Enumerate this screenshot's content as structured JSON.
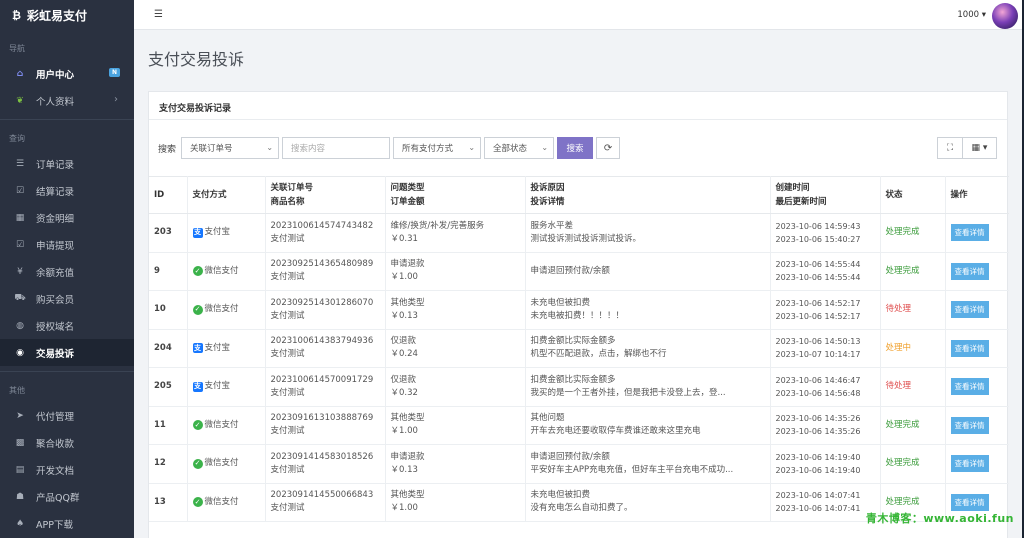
{
  "brand": {
    "logo": "₿",
    "name": "彩虹易支付"
  },
  "sidebar": {
    "section_nav": "导航",
    "section_query": "查询",
    "section_other": "其他",
    "nav_items": [
      {
        "label": "用户中心",
        "icon": "house-icon",
        "glyph": "⌂",
        "badge": "N"
      },
      {
        "label": "个人资料",
        "icon": "leaf-icon",
        "glyph": "❦",
        "arrow": "›"
      }
    ],
    "query_items": [
      {
        "label": "订单记录",
        "icon": "list-icon",
        "glyph": "☰"
      },
      {
        "label": "结算记录",
        "icon": "check-square-icon",
        "glyph": "☑"
      },
      {
        "label": "资金明细",
        "icon": "table-icon",
        "glyph": "▦"
      },
      {
        "label": "申请提现",
        "icon": "edit-icon",
        "glyph": "☑"
      },
      {
        "label": "余额充值",
        "icon": "yen-icon",
        "glyph": "¥"
      },
      {
        "label": "购买会员",
        "icon": "cart-icon",
        "glyph": "⛟"
      },
      {
        "label": "授权域名",
        "icon": "globe-icon",
        "glyph": "◍"
      },
      {
        "label": "交易投诉",
        "icon": "chat-icon",
        "glyph": "◉"
      }
    ],
    "other_items": [
      {
        "label": "代付管理",
        "icon": "send-icon",
        "glyph": "➤"
      },
      {
        "label": "聚合收款",
        "icon": "qrcode-icon",
        "glyph": "▩"
      },
      {
        "label": "开发文档",
        "icon": "book-icon",
        "glyph": "▤"
      },
      {
        "label": "产品QQ群",
        "icon": "qq-icon",
        "glyph": "☗"
      },
      {
        "label": "APP下载",
        "icon": "android-icon",
        "glyph": "♠"
      }
    ]
  },
  "topbar": {
    "account": "1000",
    "caret": "▾",
    "menu_glyph": "☰"
  },
  "page": {
    "title": "支付交易投诉"
  },
  "panel": {
    "title": "支付交易投诉记录"
  },
  "toolbar": {
    "search_label": "搜索",
    "field_select": "关联订单号",
    "search_placeholder": "搜索内容",
    "paytype_select": "所有支付方式",
    "status_select": "全部状态",
    "search_button": "搜索",
    "refresh_glyph": "⟳",
    "fullscreen_glyph": "⛶",
    "columns_glyph": "▦ ▾"
  },
  "table": {
    "headers": {
      "id": "ID",
      "pay": "支付方式",
      "order_1": "关联订单号",
      "order_2": "商品名称",
      "type_1": "问题类型",
      "type_2": "订单金额",
      "reason_1": "投诉原因",
      "reason_2": "投诉详情",
      "time_1": "创建时间",
      "time_2": "最后更新时间",
      "status": "状态",
      "op": "操作"
    },
    "rows": [
      {
        "id": "203",
        "pay": "支付宝",
        "pay_type": "alipay",
        "order": "2023100614574743482",
        "product": "支付测试",
        "type": "维修/换货/补发/完善服务",
        "amount": "￥0.31",
        "reason": "服务水平差",
        "detail": "测试投诉测试投诉测试投诉。",
        "created": "2023-10-06 14:59:43",
        "updated": "2023-10-06 15:40:27",
        "status": "处理完成",
        "status_kind": "done",
        "op": "查看详情"
      },
      {
        "id": "9",
        "pay": "微信支付",
        "pay_type": "wechat",
        "order": "2023092514365480989",
        "product": "支付测试",
        "type": "申请退款",
        "amount": "￥1.00",
        "reason": "申请退回预付款/余额",
        "detail": "",
        "created": "2023-10-06 14:55:44",
        "updated": "2023-10-06 14:55:44",
        "status": "处理完成",
        "status_kind": "done",
        "op": "查看详情"
      },
      {
        "id": "10",
        "pay": "微信支付",
        "pay_type": "wechat",
        "order": "2023092514301286070",
        "product": "支付测试",
        "type": "其他类型",
        "amount": "￥0.13",
        "reason": "未充电但被扣费",
        "detail": "未充电被扣费！！！！！",
        "created": "2023-10-06 14:52:17",
        "updated": "2023-10-06 14:52:17",
        "status": "待处理",
        "status_kind": "wait",
        "op": "查看详情"
      },
      {
        "id": "204",
        "pay": "支付宝",
        "pay_type": "alipay",
        "order": "2023100614383794936",
        "product": "支付测试",
        "type": "仅退款",
        "amount": "￥0.24",
        "reason": "扣费金额比实际金额多",
        "detail": "机型不匹配退款，点击，解绑也不行",
        "created": "2023-10-06 14:50:13",
        "updated": "2023-10-07 10:14:17",
        "status": "处理中",
        "status_kind": "proc",
        "op": "查看详情"
      },
      {
        "id": "205",
        "pay": "支付宝",
        "pay_type": "alipay",
        "order": "2023100614570091729",
        "product": "支付测试",
        "type": "仅退款",
        "amount": "￥0.32",
        "reason": "扣费金额比实际金额多",
        "detail": "我买的是一个王者外挂，但是我把卡没登上去，登...",
        "created": "2023-10-06 14:46:47",
        "updated": "2023-10-06 14:56:48",
        "status": "待处理",
        "status_kind": "wait",
        "op": "查看详情"
      },
      {
        "id": "11",
        "pay": "微信支付",
        "pay_type": "wechat",
        "order": "2023091613103888769",
        "product": "支付测试",
        "type": "其他类型",
        "amount": "￥1.00",
        "reason": "其他问题",
        "detail": "开车去充电还要收取停车费谁还敢来这里充电",
        "created": "2023-10-06 14:35:26",
        "updated": "2023-10-06 14:35:26",
        "status": "处理完成",
        "status_kind": "done",
        "op": "查看详情"
      },
      {
        "id": "12",
        "pay": "微信支付",
        "pay_type": "wechat",
        "order": "2023091414583018526",
        "product": "支付测试",
        "type": "申请退款",
        "amount": "￥0.13",
        "reason": "申请退回预付款/余额",
        "detail": "平安好车主APP充电充值，但好车主平台充电不成功...",
        "created": "2023-10-06 14:19:40",
        "updated": "2023-10-06 14:19:40",
        "status": "处理完成",
        "status_kind": "done",
        "op": "查看详情"
      },
      {
        "id": "13",
        "pay": "微信支付",
        "pay_type": "wechat",
        "order": "2023091414550066843",
        "product": "支付测试",
        "type": "其他类型",
        "amount": "￥1.00",
        "reason": "未充电但被扣费",
        "detail": "没有充电怎么自动扣费了。",
        "created": "2023-10-06 14:07:41",
        "updated": "2023-10-06 14:07:41",
        "status": "处理完成",
        "status_kind": "done",
        "op": "查看详情"
      }
    ]
  },
  "watermark": "青木博客：www.aoki.fun"
}
